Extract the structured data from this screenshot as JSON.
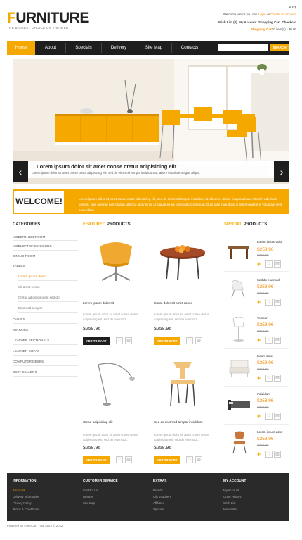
{
  "header": {
    "logo_first": "F",
    "logo_rest": "URNITURE",
    "tagline": "THE BIGGEST CHOICE ON THE WEB",
    "currencies": "€ £ $",
    "welcome_prefix": "Welcome visitor you can",
    "login": "Login",
    "or": "or",
    "create_account": "Create an account",
    "links": [
      "Wish List (0)",
      "My Account",
      "Shopping Cart",
      "Checkout"
    ],
    "cart_label": "Shopping Cart",
    "cart_summary": "0 item(s) - $0.00"
  },
  "nav": {
    "items": [
      "Home",
      "About",
      "Specials",
      "Delivery",
      "Site Map",
      "Contacts"
    ],
    "search_label": "SEARCH"
  },
  "slider": {
    "caption_title": "Lorem ipsum dolor sit amet conse ctetur adipisicing elit",
    "caption_text": "Lorem ipsum dolor sit amet conse ctetur adipisicing elit, sed do eiusmod tempor incididunt ut labore et dolore magna aliqua."
  },
  "welcome": {
    "title": "WELCOME!",
    "text": "Lorem ipsum dolor sit amet conse ctetur adipisicing elit, sed do eiusmod tempor incididunt ut labore et dolore magna aliqua. Ut enim ad minim veniam, quis nostrud exercitation ullamco laboris nisi ut aliquip ex ea commodo consequat. Duis aute irure dolor in reprehenderit in voluptate velit esse cillum."
  },
  "categories": {
    "title_a": "CATEGORIES",
    "items": [
      "MODERN BEDROOM",
      "MODLOFT CASE GOODS",
      "DINING ROOM",
      "TABLES"
    ],
    "sub_items": [
      "Lorem ipsum dolor",
      "Sit amet conse",
      "Ctetur adipisicing elit sed do",
      "Eiusmod tempor"
    ],
    "items_after": [
      "CHAIRS",
      "MIRRORS",
      "LEATHER SECTIONALS",
      "LEATHER SOFAS",
      "COMPUTER DESKS",
      "BEST SELLERS"
    ]
  },
  "featured": {
    "title_a": "FEATURED",
    "title_b": " PRODUCTS",
    "add_to_cart": "ADD TO CART",
    "products": [
      {
        "name": "Lorem ipsum dolor sit",
        "desc": "Lorem ipsum dolor sit amet conse ctetur adipisicing elit, sed do eiusmod...",
        "price": "$258.96"
      },
      {
        "name": "Ipsum dolor sit amet conse",
        "desc": "Lorem ipsum dolor sit amet conse ctetur adipisicing elit, sed do eiusmod...",
        "price": "$258.96"
      },
      {
        "name": "Ctetur adipisicing elit",
        "desc": "Lorem ipsum dolor sit amet conse ctetur adipisicing elit, sed do eiusmod...",
        "price": "$258.96"
      },
      {
        "name": "Sed do eiusmod tempor incididunt",
        "desc": "Lorem ipsum dolor sit amet conse ctetur adipisicing elit, sed do eiusmod...",
        "price": "$258.96"
      }
    ]
  },
  "specials": {
    "title_a": "SPECIAL",
    "title_b": " PRODUCTS",
    "products": [
      {
        "name": "Lorem ipsum dolor",
        "price": "$258.96",
        "old": "$358.96"
      },
      {
        "name": "Sed do eiusmod",
        "price": "$258.96",
        "old": "$358.96"
      },
      {
        "name": "Tempor",
        "price": "$258.96",
        "old": "$358.96"
      },
      {
        "name": "Ipsum dolor",
        "price": "$258.96",
        "old": "$358.96"
      },
      {
        "name": "Incididunt",
        "price": "$258.96",
        "old": "$358.96"
      },
      {
        "name": "Lorem ipsum dolor",
        "price": "$258.96",
        "old": "$358.96"
      }
    ]
  },
  "footer": {
    "columns": [
      {
        "title": "INFORMATION",
        "links": [
          "About Us",
          "Delivery Information",
          "Privacy Policy",
          "Terms & Conditions"
        ]
      },
      {
        "title": "CUSTOMER SERVICE",
        "links": [
          "Contact Us",
          "Returns",
          "Site Map"
        ]
      },
      {
        "title": "EXTRAS",
        "links": [
          "Brands",
          "Gift Vouchers",
          "Affiliates",
          "Specials"
        ]
      },
      {
        "title": "MY ACCOUNT",
        "links": [
          "My Account",
          "Order History",
          "Wish List",
          "Newsletter"
        ]
      }
    ],
    "powered": "Powered By OpenCart Your Store © 2012"
  },
  "colors": {
    "accent": "#f5a800",
    "dark": "#1e1e1e"
  }
}
